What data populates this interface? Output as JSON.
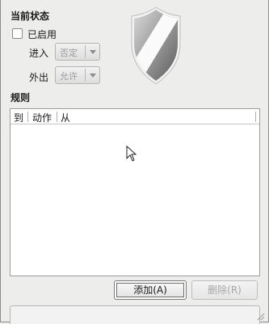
{
  "current_state": {
    "title": "当前状态",
    "enabled_label": "已启用",
    "enabled_checked": false
  },
  "incoming": {
    "label": "进入",
    "value": "否定"
  },
  "outgoing": {
    "label": "外出",
    "value": "允许"
  },
  "shield_icon": "shield-icon",
  "rules": {
    "title": "规则",
    "columns": [
      "到",
      "动作",
      "从"
    ],
    "rows": []
  },
  "buttons": {
    "add": "添加(A)",
    "delete": "删除(R)"
  }
}
